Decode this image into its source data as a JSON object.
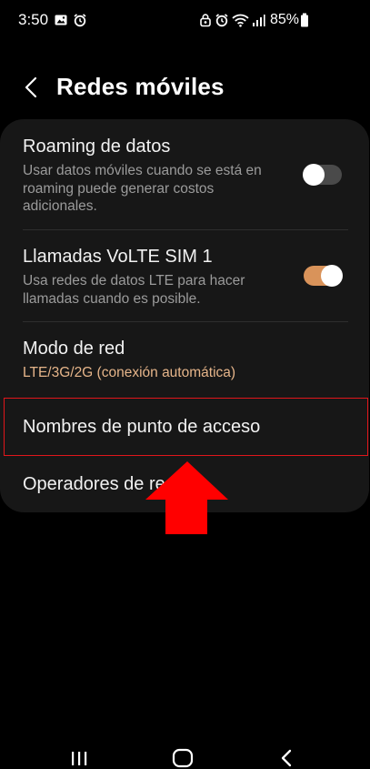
{
  "status_bar": {
    "time": "3:50",
    "battery_percent": "85%",
    "icons": [
      "image-icon",
      "alarm-icon",
      "lock-notification-icon",
      "alarm-icon",
      "wifi-icon",
      "signal-icon",
      "battery-icon"
    ]
  },
  "header": {
    "title": "Redes móviles"
  },
  "settings": {
    "items": [
      {
        "title": "Roaming de datos",
        "subtitle": "Usar datos móviles cuando se está en roaming puede generar costos adicionales.",
        "toggle": "off"
      },
      {
        "title": "Llamadas VoLTE SIM 1",
        "subtitle": "Usa redes de datos LTE para hacer llamadas cuando es posible.",
        "toggle": "on"
      },
      {
        "title": "Modo de red",
        "subtitle": "LTE/3G/2G (conexión automática)"
      },
      {
        "title": "Nombres de punto de acceso"
      },
      {
        "title": "Operadores de red"
      }
    ]
  },
  "colors": {
    "background": "#000000",
    "card": "#171717",
    "accent": "#d9935a",
    "accent_text": "#e6b58a",
    "highlight": "#e0161b",
    "arrow": "#ff0000"
  },
  "nav_bar": {
    "icons": [
      "recents-icon",
      "home-icon",
      "back-icon"
    ]
  }
}
